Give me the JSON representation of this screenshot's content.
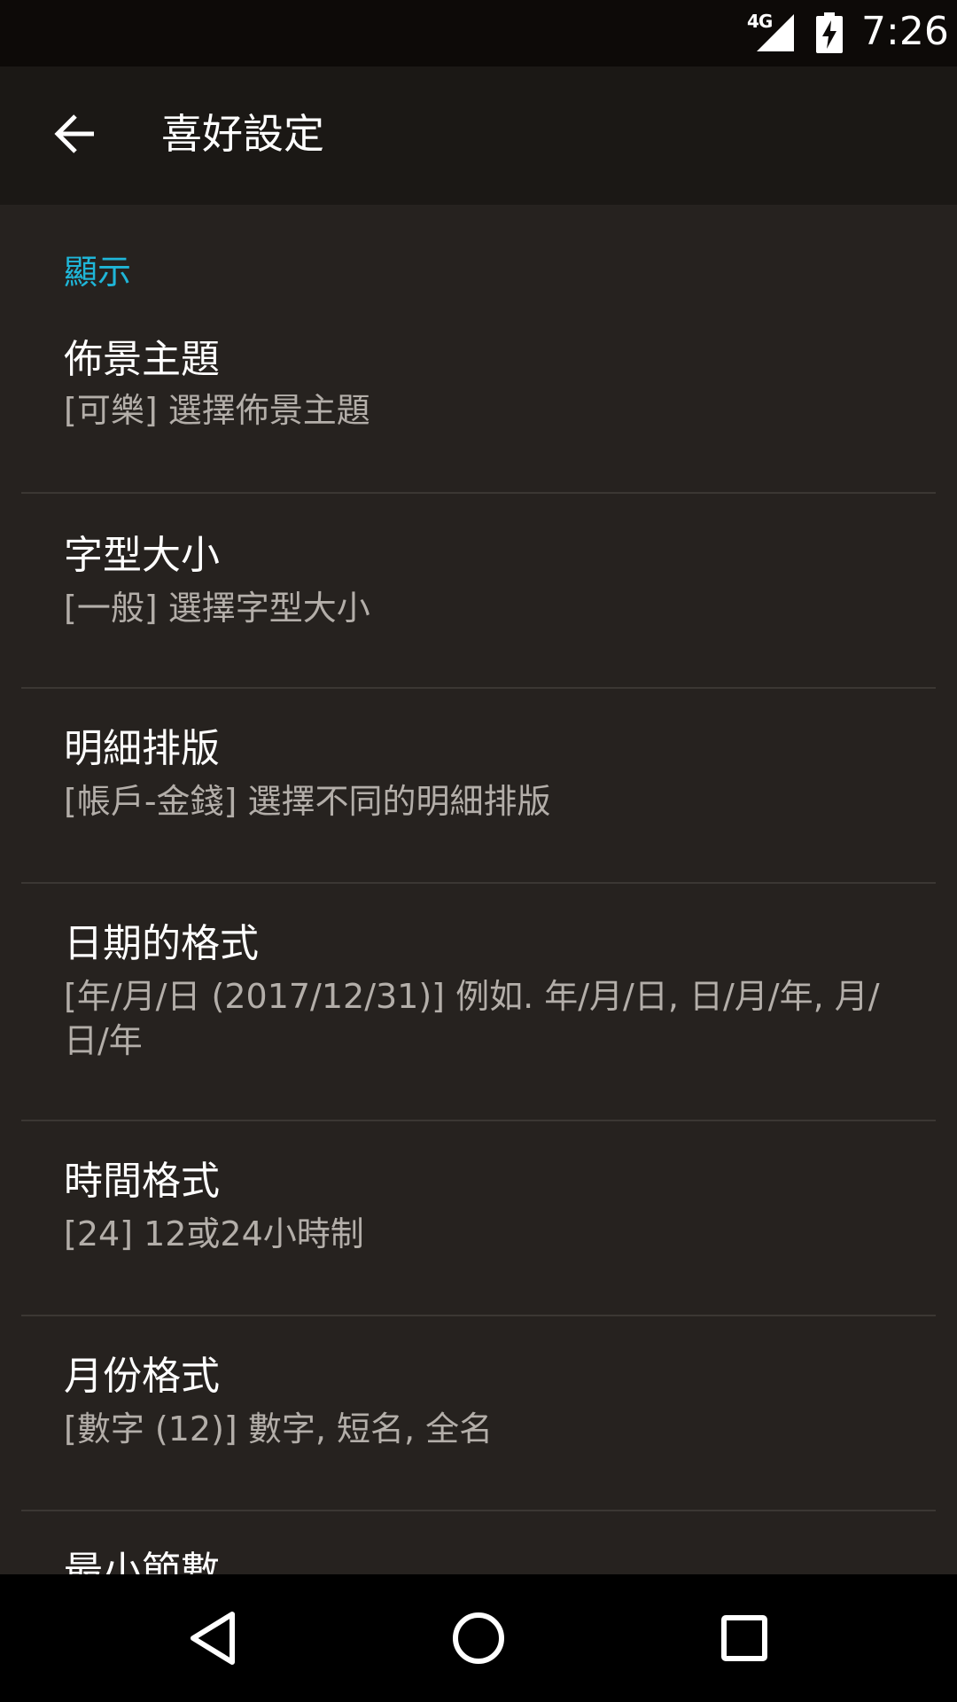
{
  "status_bar": {
    "network": "4G",
    "time": "7:26"
  },
  "app_bar": {
    "title": "喜好設定"
  },
  "section": {
    "header": "顯示"
  },
  "preferences": [
    {
      "title": "佈景主題",
      "summary": "[可樂] 選擇佈景主題"
    },
    {
      "title": "字型大小",
      "summary": "[一般] 選擇字型大小"
    },
    {
      "title": "明細排版",
      "summary": "[帳戶-金錢] 選擇不同的明細排版"
    },
    {
      "title": "日期的格式",
      "summary": "[年/月/日 (2017/12/31)] 例如. 年/月/日, 日/月/年, 月/日/年"
    },
    {
      "title": "時間格式",
      "summary": "[24] 12或24小時制"
    },
    {
      "title": "月份格式",
      "summary": "[數字 (12)] 數字, 短名, 全名"
    },
    {
      "title": "最小節數",
      "summary": ""
    }
  ],
  "colors": {
    "accent": "#1fb6d8",
    "background": "#26221f",
    "app_bar": "#1b1815"
  }
}
